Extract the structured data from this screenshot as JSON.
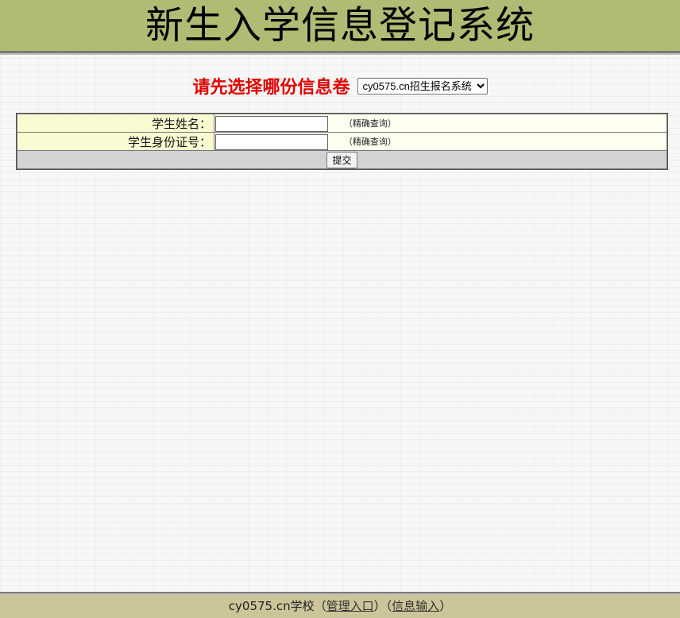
{
  "header": {
    "title": "新生入学信息登记系统"
  },
  "selector": {
    "prompt": "请先选择哪份信息卷",
    "selected": "cy0575.cn招生报名系统"
  },
  "form": {
    "rows": [
      {
        "label": "学生姓名：",
        "value": "",
        "hint": "（精确查询）"
      },
      {
        "label": "学生身份证号：",
        "value": "",
        "hint": "（精确查询）"
      }
    ],
    "submit_label": "提交"
  },
  "footer": {
    "site": "cy0575.cn学校",
    "open_paren_1": "（",
    "admin_link": "管理入口",
    "close_paren_1": "）",
    "open_paren_2": "（",
    "input_link": "信息输入",
    "close_paren_2": "）"
  },
  "colors": {
    "header_bg": "#b0bc74",
    "prompt_red": "#e00000",
    "label_bg": "#fafad2",
    "footer_bg": "#cdc59a"
  }
}
